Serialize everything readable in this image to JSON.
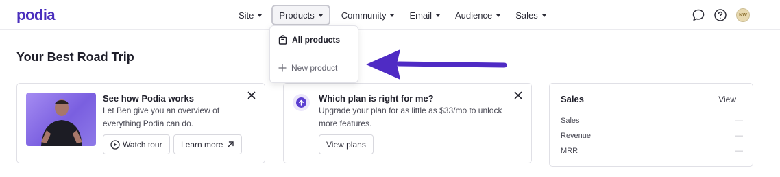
{
  "brand": {
    "logo_text": "podia",
    "accent": "#4a2fbd"
  },
  "nav": {
    "items": [
      {
        "label": "Site"
      },
      {
        "label": "Products"
      },
      {
        "label": "Community"
      },
      {
        "label": "Email"
      },
      {
        "label": "Audience"
      },
      {
        "label": "Sales"
      }
    ],
    "active": "Products"
  },
  "header_icons": {
    "chat_icon": "chat-bubble-icon",
    "help_icon": "question-circle-icon",
    "avatar_initials": "NW"
  },
  "products_dropdown": {
    "items": [
      {
        "label": "All products",
        "icon": "shopping-bag-icon"
      },
      {
        "label": "New product",
        "icon": "plus-icon"
      }
    ]
  },
  "page": {
    "title": "Your Best Road Trip"
  },
  "cards": {
    "video": {
      "title": "See how Podia works",
      "description": "Let Ben give you an overview of everything Podia can do.",
      "watch_label": "Watch tour",
      "learn_label": "Learn more"
    },
    "plan": {
      "title": "Which plan is right for me?",
      "description": "Upgrade your plan for as little as $33/mo to unlock more features.",
      "view_label": "View plans"
    },
    "sales": {
      "title": "Sales",
      "view_label": "View",
      "stats": [
        {
          "label": "Sales",
          "value": "—"
        },
        {
          "label": "Revenue",
          "value": "—"
        },
        {
          "label": "MRR",
          "value": "—"
        }
      ]
    }
  }
}
